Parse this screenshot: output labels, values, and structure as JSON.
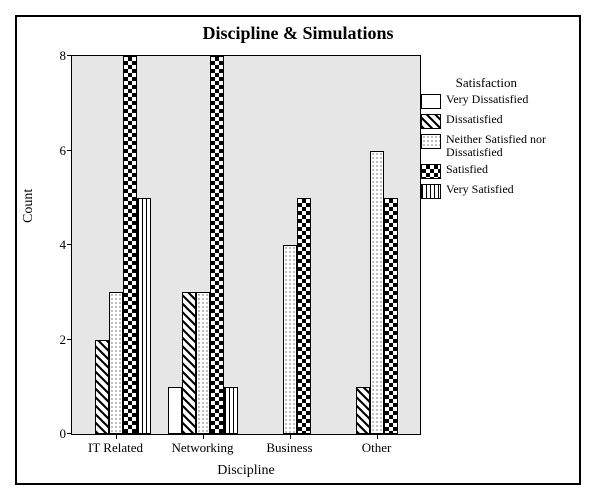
{
  "chart_data": {
    "type": "bar",
    "title": "Discipline & Simulations",
    "xlabel": "Discipline",
    "ylabel": "Count",
    "ylim": [
      0,
      8
    ],
    "yticks": [
      0,
      2,
      4,
      6,
      8
    ],
    "legend_title": "Satisfaction",
    "categories": [
      "IT Related",
      "Networking",
      "Business",
      "Other"
    ],
    "series": [
      {
        "name": "Very Dissatisfied",
        "values": [
          0,
          1,
          0,
          0
        ],
        "pattern": "fill-white"
      },
      {
        "name": "Dissatisfied",
        "values": [
          2,
          3,
          0,
          1
        ],
        "pattern": "fill-diag"
      },
      {
        "name": "Neither Satisfied nor Dissatisfied",
        "values": [
          3,
          3,
          4,
          6
        ],
        "pattern": "fill-dots"
      },
      {
        "name": "Satisfied",
        "values": [
          8,
          8,
          5,
          5
        ],
        "pattern": "fill-checker"
      },
      {
        "name": "Very Satisfied",
        "values": [
          5,
          1,
          0,
          0
        ],
        "pattern": "fill-vert"
      }
    ]
  }
}
